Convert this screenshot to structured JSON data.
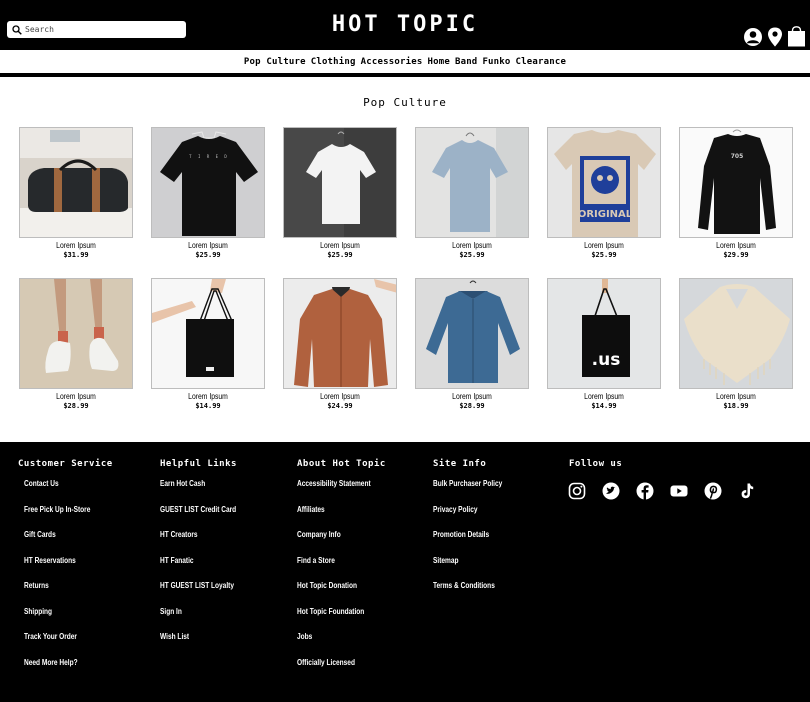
{
  "header": {
    "search_placeholder": "Search",
    "logo": "HOT TOPIC",
    "icons": [
      "user-icon",
      "location-pin-icon",
      "shopping-bag-icon"
    ]
  },
  "nav": {
    "items": [
      "Pop Culture",
      "Clothing",
      "Accessories",
      "Home",
      "Band",
      "Funko",
      "Clearance"
    ]
  },
  "section": {
    "title": "Pop Culture"
  },
  "products": [
    {
      "name": "Lorem Ipsum",
      "price": "$31.99",
      "image": "duffel-bag"
    },
    {
      "name": "Lorem Ipsum",
      "price": "$25.99",
      "image": "black-tshirt"
    },
    {
      "name": "Lorem Ipsum",
      "price": "$25.99",
      "image": "white-tshirt"
    },
    {
      "name": "Lorem Ipsum",
      "price": "$25.99",
      "image": "heather-blue-tshirt"
    },
    {
      "name": "Lorem Ipsum",
      "price": "$25.99",
      "image": "graphic-tshirt"
    },
    {
      "name": "Lorem Ipsum",
      "price": "$29.99",
      "image": "black-longsleeve"
    },
    {
      "name": "Lorem Ipsum",
      "price": "$28.99",
      "image": "socks"
    },
    {
      "name": "Lorem Ipsum",
      "price": "$14.99",
      "image": "black-tote"
    },
    {
      "name": "Lorem Ipsum",
      "price": "$24.99",
      "image": "rust-jacket"
    },
    {
      "name": "Lorem Ipsum",
      "price": "$28.99",
      "image": "denim-shirt"
    },
    {
      "name": "Lorem Ipsum",
      "price": "$14.99",
      "image": "us-tote"
    },
    {
      "name": "Lorem Ipsum",
      "price": "$18.99",
      "image": "knit-poncho"
    }
  ],
  "footer": {
    "customer_service": {
      "title": "Customer Service",
      "links": [
        "Contact Us",
        "Free Pick Up In-Store",
        "Gift Cards",
        "HT Reservations",
        "Returns",
        "Shipping",
        "Track Your Order",
        "Need More Help?"
      ]
    },
    "helpful_links": {
      "title": "Helpful Links",
      "links": [
        "Earn Hot Cash",
        "GUEST LIST Credit Card",
        "HT Creators",
        "HT Fanatic",
        "HT GUEST LIST Loyalty",
        "Sign In",
        "Wish List"
      ]
    },
    "about": {
      "title": "About Hot Topic",
      "links": [
        "Accessibility Statement",
        "Affiliates",
        "Company Info",
        "Find a Store",
        "Hot Topic Donation",
        "Hot Topic Foundation",
        "Jobs",
        "Officially Licensed"
      ]
    },
    "site_info": {
      "title": "Site Info",
      "links": [
        "Bulk Purchaser Policy",
        "Privacy Policy",
        "Promotion Details",
        "Sitemap",
        "Terms & Conditions"
      ]
    },
    "follow": {
      "title": "Follow us",
      "icons": [
        "instagram-icon",
        "twitter-icon",
        "facebook-icon",
        "youtube-icon",
        "pinterest-icon",
        "tiktok-icon"
      ]
    }
  }
}
